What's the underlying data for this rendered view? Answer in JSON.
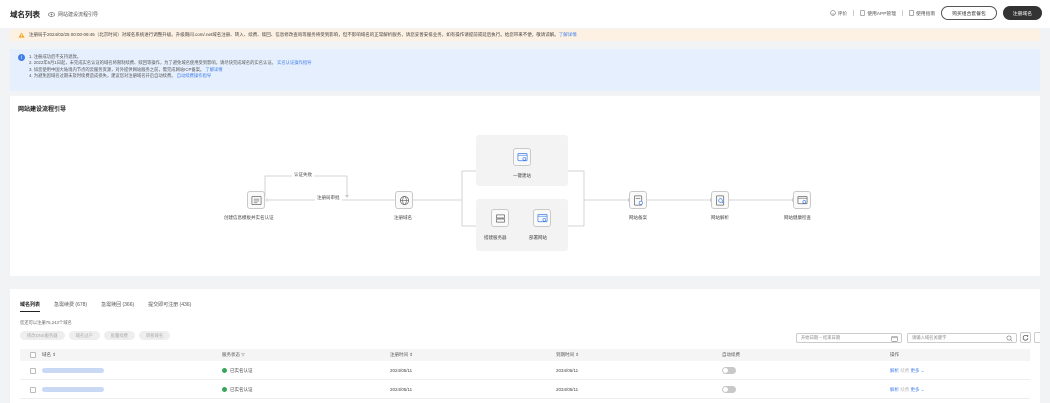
{
  "header": {
    "title": "域名列表",
    "subtitle": "网站建设流程引导",
    "links": [
      "评价",
      "使用APP管理",
      "使用指南"
    ],
    "btn_portfolio": "购买组合套餐包",
    "btn_register": "注册域名"
  },
  "warning": {
    "text": "注册局于2024/02/25 00:00-09:45（北京时间）对域名系统进行调整升级。升级期间.com/.net域名注册、转入、续费、赎回、信息修改查询等服务将受到影响，但不影响域名的正常解析服务，请您妥善安排业务，如有操作请提前或延后执行。给您带来不便，敬请谅解。",
    "link": "了解详情"
  },
  "info": {
    "lines": [
      "1. 注册成功后不支持退款。",
      "2. 2022年6月1日起，未完成实名认证的域名将限制续费、赎回等操作，为了避免域名使用受到影响，请尽快完成域名的实名认证。",
      "3. 如您使用中国大陆境内节点的云服务资源，对外提供网站服务之前，需完成网站ICP备案。",
      "4. 为避免因域名过期未及时续费造成损失，建议您对注册域名开启自动续费。"
    ],
    "link_line2": "实名认证操作指导",
    "link_line3": "了解详情",
    "link_line4": "自动续费操作指导"
  },
  "guide": {
    "title": "网站建设流程引导",
    "nodes": {
      "template": "创建信息模板并实名认证",
      "register": "注册域名",
      "quick_build": "一键建站",
      "build_server": "搭建服务器",
      "deploy": "部署网站",
      "icp": "网站备案",
      "dns": "网站解析",
      "health": "网站健康检查"
    },
    "edges": {
      "fail": "认证失败",
      "approved": "注册局审批"
    }
  },
  "table": {
    "tabs": [
      "域名列表",
      "急需续费 (678)",
      "急需赎回 (366)",
      "提交即可注册 (436)"
    ],
    "count_note": "您还可以注册75,243个域名",
    "batch_buttons": [
      "修改DNS服务器",
      "域名过户",
      "批量续费",
      "转移域名"
    ],
    "date_placeholder": "开始日期 – 结束日期",
    "search_placeholder": "请输入域名关键字",
    "columns": [
      "域名",
      "服务状态",
      "注册时间",
      "到期时间",
      "自动续费",
      "操作"
    ],
    "rows": [
      {
        "status": "已实名认证",
        "registered": "2024/05/11",
        "expires": "2034/05/11",
        "ops_resolve": "解析",
        "ops_renew": "续费",
        "ops_more": "更多"
      },
      {
        "status": "已实名认证",
        "registered": "2024/05/11",
        "expires": "2034/05/11",
        "ops_resolve": "解析",
        "ops_renew": "续费",
        "ops_more": "更多"
      }
    ]
  },
  "colors": {
    "accent": "#3f7ee8",
    "success": "#3aa55a",
    "warning_bg": "#fdf1e3",
    "warning_icon": "#f5a623",
    "info_bg": "#e6effd"
  }
}
